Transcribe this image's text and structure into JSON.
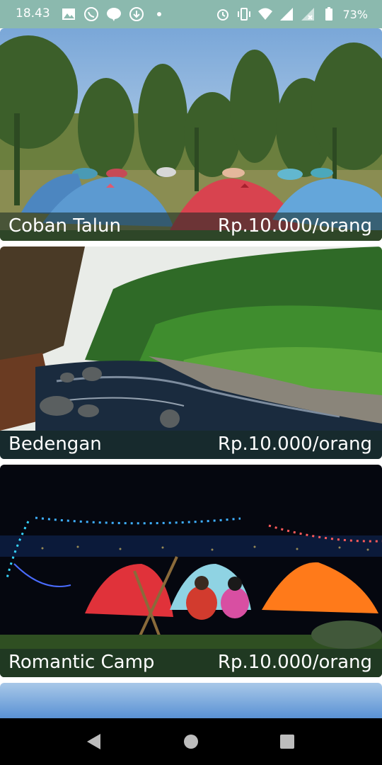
{
  "status_bar": {
    "time": "18.43",
    "battery": "73%",
    "left_icons": [
      "gallery-icon",
      "whatsapp-icon",
      "line-icon",
      "download-icon",
      "dot-icon"
    ],
    "right_icons": [
      "alarm-icon",
      "vibrate-icon",
      "wifi-icon",
      "signal-icon",
      "signal-x-icon"
    ]
  },
  "places": [
    {
      "name": "Coban Talun",
      "price": "Rp.10.000/orang"
    },
    {
      "name": "Bedengan",
      "price": "Rp.10.000/orang"
    },
    {
      "name": "Romantic Camp",
      "price": "Rp.10.000/orang"
    }
  ],
  "nav": {
    "back": "back-icon",
    "home": "home-icon",
    "recents": "recents-icon"
  },
  "colors": {
    "status_bar": "#8bb9ae",
    "caption_bg": "#142823",
    "nav_bar": "#000000"
  }
}
